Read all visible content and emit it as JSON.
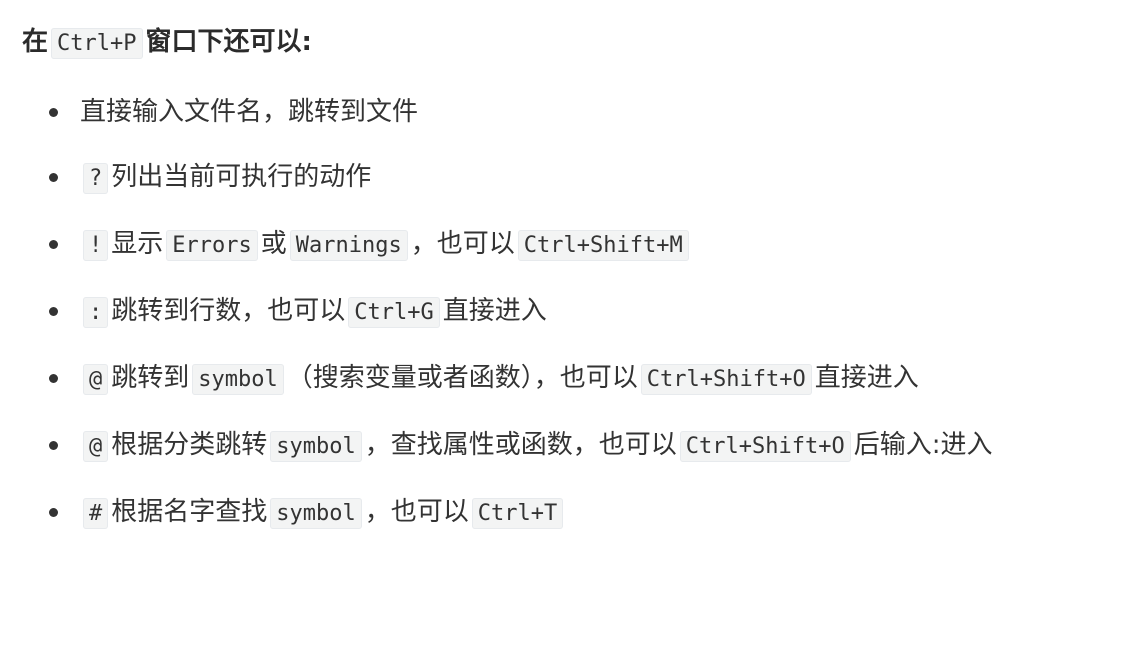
{
  "heading": {
    "prefix": "在",
    "shortcut": "Ctrl+P",
    "suffix": "窗口下还可以:"
  },
  "items": [
    {
      "parts": [
        {
          "text": "直接输入文件名，跳转到文件"
        }
      ]
    },
    {
      "parts": [
        {
          "code": "?"
        },
        {
          "text": "列出当前可执行的动作"
        }
      ]
    },
    {
      "parts": [
        {
          "code": "!"
        },
        {
          "text": "显示"
        },
        {
          "code": "Errors"
        },
        {
          "text": "或"
        },
        {
          "code": "Warnings"
        },
        {
          "text": "，也可以"
        },
        {
          "code": "Ctrl+Shift+M"
        }
      ]
    },
    {
      "parts": [
        {
          "code": ":"
        },
        {
          "text": "跳转到行数，也可以"
        },
        {
          "code": "Ctrl+G"
        },
        {
          "text": "直接进入"
        }
      ]
    },
    {
      "parts": [
        {
          "code": "@"
        },
        {
          "text": "跳转到"
        },
        {
          "code": "symbol"
        },
        {
          "text": "（搜索变量或者函数），也可以"
        },
        {
          "code": "Ctrl+Shift+O"
        },
        {
          "text": "直接进入"
        }
      ]
    },
    {
      "parts": [
        {
          "code": "@"
        },
        {
          "text": "根据分类跳转"
        },
        {
          "code": "symbol"
        },
        {
          "text": "，查找属性或函数，也可以"
        },
        {
          "code": "Ctrl+Shift+O"
        },
        {
          "text": "后输入:进入"
        }
      ]
    },
    {
      "parts": [
        {
          "code": "#"
        },
        {
          "text": "根据名字查找"
        },
        {
          "code": "symbol"
        },
        {
          "text": "，也可以"
        },
        {
          "code": "Ctrl+T"
        }
      ]
    }
  ]
}
